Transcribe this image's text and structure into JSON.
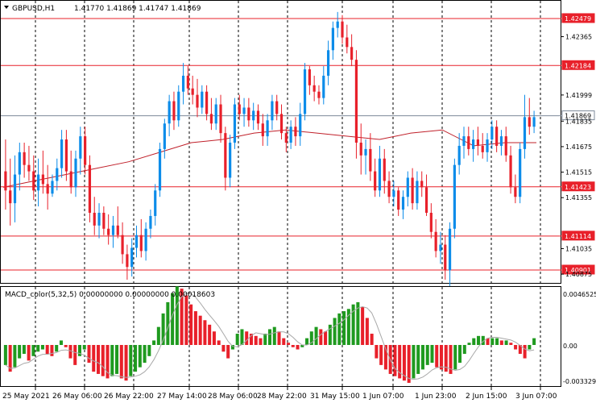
{
  "header": {
    "symbol": "GBPUSD,H1",
    "ohlc": "1.41770 1.41869 1.41747 1.41869"
  },
  "macd": {
    "label": "MACD_color(5,32,5) 0.00000000 0.00000000 0.00018603",
    "axis_labels": [
      "0.0046525",
      "0.00",
      "-0.003329"
    ]
  },
  "price_axis": {
    "labels": [
      "1.42479",
      "1.42365",
      "1.42184",
      "1.41999",
      "1.41869",
      "1.41835",
      "1.41675",
      "1.41515",
      "1.41423",
      "1.41355",
      "1.41114",
      "1.41035",
      "1.40901",
      "1.40875"
    ]
  },
  "levels": [
    {
      "value": "1.42479",
      "color": "#e8202a"
    },
    {
      "value": "1.42184",
      "color": "#e8202a"
    },
    {
      "value": "1.41869",
      "color": "#7d8a99",
      "current": true
    },
    {
      "value": "1.41423",
      "color": "#e8202a"
    },
    {
      "value": "1.41114",
      "color": "#e8202a"
    },
    {
      "value": "1.40901",
      "color": "#e8202a"
    }
  ],
  "time_axis": {
    "labels": [
      "25 May 2021",
      "26 May 06:00",
      "26 May 22:00",
      "27 May 14:00",
      "28 May 06:00",
      "28 May 22:00",
      "31 May 15:00",
      "1 Jun 07:00",
      "1 Jun 23:00",
      "2 Jun 15:00",
      "3 Jun 07:00"
    ]
  },
  "chart_data": {
    "type": "candlestick",
    "symbol": "GBPUSD",
    "timeframe": "H1",
    "ylim": [
      1.4082,
      1.4259
    ],
    "candles": [
      [
        1.4152,
        1.4172,
        1.4128,
        1.414
      ],
      [
        1.414,
        1.416,
        1.4118,
        1.4132
      ],
      [
        1.4132,
        1.4162,
        1.412,
        1.415
      ],
      [
        1.415,
        1.417,
        1.414,
        1.4164
      ],
      [
        1.4164,
        1.417,
        1.4148,
        1.4156
      ],
      [
        1.4156,
        1.4168,
        1.4146,
        1.4152
      ],
      [
        1.4152,
        1.4162,
        1.4134,
        1.414
      ],
      [
        1.414,
        1.416,
        1.413,
        1.415
      ],
      [
        1.415,
        1.4165,
        1.4138,
        1.4144
      ],
      [
        1.4144,
        1.4156,
        1.4128,
        1.4138
      ],
      [
        1.4138,
        1.415,
        1.4136,
        1.4146
      ],
      [
        1.4146,
        1.416,
        1.414,
        1.4154
      ],
      [
        1.4154,
        1.4178,
        1.4148,
        1.4172
      ],
      [
        1.4172,
        1.4178,
        1.4146,
        1.4152
      ],
      [
        1.4152,
        1.4165,
        1.4138,
        1.4142
      ],
      [
        1.4142,
        1.4165,
        1.4136,
        1.416
      ],
      [
        1.416,
        1.418,
        1.415,
        1.4174
      ],
      [
        1.4174,
        1.418,
        1.415,
        1.4156
      ],
      [
        1.4156,
        1.4162,
        1.412,
        1.4126
      ],
      [
        1.4126,
        1.4136,
        1.4112,
        1.4118
      ],
      [
        1.4118,
        1.4132,
        1.411,
        1.4126
      ],
      [
        1.4126,
        1.413,
        1.4112,
        1.4116
      ],
      [
        1.4116,
        1.4125,
        1.4106,
        1.4112
      ],
      [
        1.4112,
        1.4124,
        1.4104,
        1.4118
      ],
      [
        1.4118,
        1.413,
        1.411,
        1.4112
      ],
      [
        1.4112,
        1.412,
        1.4094,
        1.41
      ],
      [
        1.41,
        1.4106,
        1.4084,
        1.4092
      ],
      [
        1.4092,
        1.411,
        1.4086,
        1.4104
      ],
      [
        1.4104,
        1.4118,
        1.4098,
        1.4112
      ],
      [
        1.4112,
        1.4122,
        1.4098,
        1.4102
      ],
      [
        1.4102,
        1.412,
        1.4096,
        1.4116
      ],
      [
        1.4116,
        1.4128,
        1.411,
        1.4124
      ],
      [
        1.4124,
        1.4144,
        1.4118,
        1.414
      ],
      [
        1.414,
        1.417,
        1.4136,
        1.4166
      ],
      [
        1.4166,
        1.4185,
        1.416,
        1.4182
      ],
      [
        1.4182,
        1.42,
        1.4174,
        1.4196
      ],
      [
        1.4196,
        1.4202,
        1.4178,
        1.4184
      ],
      [
        1.4184,
        1.4206,
        1.418,
        1.4202
      ],
      [
        1.4202,
        1.422,
        1.4194,
        1.4212
      ],
      [
        1.4212,
        1.4218,
        1.42,
        1.4204
      ],
      [
        1.4204,
        1.4212,
        1.4194,
        1.42
      ],
      [
        1.42,
        1.421,
        1.4186,
        1.4192
      ],
      [
        1.4192,
        1.4206,
        1.4188,
        1.4202
      ],
      [
        1.4202,
        1.4206,
        1.4184,
        1.4188
      ],
      [
        1.4188,
        1.4198,
        1.4178,
        1.4182
      ],
      [
        1.4182,
        1.4198,
        1.4178,
        1.4194
      ],
      [
        1.4194,
        1.42,
        1.417,
        1.4176
      ],
      [
        1.4176,
        1.418,
        1.414,
        1.4148
      ],
      [
        1.4148,
        1.4175,
        1.4142,
        1.417
      ],
      [
        1.417,
        1.4198,
        1.4166,
        1.4194
      ],
      [
        1.4194,
        1.42,
        1.4184,
        1.4188
      ],
      [
        1.4188,
        1.4198,
        1.418,
        1.4192
      ],
      [
        1.4192,
        1.4198,
        1.418,
        1.4184
      ],
      [
        1.4184,
        1.4195,
        1.4178,
        1.419
      ],
      [
        1.419,
        1.4194,
        1.4178,
        1.4182
      ],
      [
        1.4182,
        1.4188,
        1.4168,
        1.4174
      ],
      [
        1.4174,
        1.4188,
        1.4168,
        1.4184
      ],
      [
        1.4184,
        1.42,
        1.4178,
        1.4196
      ],
      [
        1.4196,
        1.42,
        1.4184,
        1.4188
      ],
      [
        1.4188,
        1.4194,
        1.4172,
        1.4176
      ],
      [
        1.4176,
        1.418,
        1.4164,
        1.417
      ],
      [
        1.417,
        1.4184,
        1.4166,
        1.418
      ],
      [
        1.418,
        1.4186,
        1.4168,
        1.4174
      ],
      [
        1.4174,
        1.4195,
        1.4168,
        1.4188
      ],
      [
        1.4188,
        1.422,
        1.4184,
        1.4216
      ],
      [
        1.4216,
        1.4218,
        1.42,
        1.4206
      ],
      [
        1.4206,
        1.4212,
        1.4196,
        1.4202
      ],
      [
        1.4202,
        1.4206,
        1.4194,
        1.4198
      ],
      [
        1.4198,
        1.4218,
        1.4194,
        1.4212
      ],
      [
        1.4212,
        1.4234,
        1.4206,
        1.4228
      ],
      [
        1.4228,
        1.4246,
        1.4222,
        1.4242
      ],
      [
        1.4242,
        1.4252,
        1.4236,
        1.4246
      ],
      [
        1.4246,
        1.425,
        1.4232,
        1.4236
      ],
      [
        1.4236,
        1.4244,
        1.4226,
        1.423
      ],
      [
        1.423,
        1.4238,
        1.4218,
        1.4222
      ],
      [
        1.4222,
        1.4228,
        1.416,
        1.417
      ],
      [
        1.417,
        1.4182,
        1.415,
        1.4162
      ],
      [
        1.4162,
        1.4172,
        1.415,
        1.4166
      ],
      [
        1.4166,
        1.4176,
        1.4146,
        1.4152
      ],
      [
        1.4152,
        1.416,
        1.4136,
        1.414
      ],
      [
        1.414,
        1.4168,
        1.4136,
        1.416
      ],
      [
        1.416,
        1.4166,
        1.4138,
        1.4146
      ],
      [
        1.4146,
        1.4152,
        1.4132,
        1.4136
      ],
      [
        1.4136,
        1.4146,
        1.413,
        1.414
      ],
      [
        1.414,
        1.4142,
        1.4124,
        1.4128
      ],
      [
        1.4128,
        1.414,
        1.4122,
        1.4136
      ],
      [
        1.4136,
        1.4152,
        1.413,
        1.4148
      ],
      [
        1.4148,
        1.4154,
        1.4128,
        1.4132
      ],
      [
        1.4132,
        1.4152,
        1.4128,
        1.4146
      ],
      [
        1.4146,
        1.4152,
        1.4136,
        1.4142
      ],
      [
        1.4142,
        1.415,
        1.4124,
        1.4126
      ],
      [
        1.4126,
        1.4132,
        1.411,
        1.4114
      ],
      [
        1.4114,
        1.4122,
        1.4098,
        1.4102
      ],
      [
        1.4102,
        1.4114,
        1.4094,
        1.4106
      ],
      [
        1.4106,
        1.4112,
        1.4084,
        1.409
      ],
      [
        1.409,
        1.412,
        1.408,
        1.4116
      ],
      [
        1.4116,
        1.416,
        1.411,
        1.4156
      ],
      [
        1.4156,
        1.4176,
        1.415,
        1.4168
      ],
      [
        1.4168,
        1.418,
        1.416,
        1.4174
      ],
      [
        1.4174,
        1.418,
        1.4162,
        1.4166
      ],
      [
        1.4166,
        1.4178,
        1.4158,
        1.4172
      ],
      [
        1.4172,
        1.418,
        1.4162,
        1.4168
      ],
      [
        1.4168,
        1.4176,
        1.416,
        1.4164
      ],
      [
        1.4164,
        1.4176,
        1.4158,
        1.4172
      ],
      [
        1.4172,
        1.4184,
        1.4166,
        1.418
      ],
      [
        1.418,
        1.4184,
        1.4164,
        1.4168
      ],
      [
        1.4168,
        1.4178,
        1.4162,
        1.4174
      ],
      [
        1.4174,
        1.418,
        1.4158,
        1.4162
      ],
      [
        1.4162,
        1.4168,
        1.4138,
        1.4142
      ],
      [
        1.4142,
        1.415,
        1.4132,
        1.4136
      ],
      [
        1.4136,
        1.417,
        1.4132,
        1.4166
      ],
      [
        1.4166,
        1.42,
        1.416,
        1.4186
      ],
      [
        1.4186,
        1.4198,
        1.4175,
        1.418
      ],
      [
        1.418,
        1.419,
        1.4176,
        1.4186
      ]
    ],
    "moving_average": [
      1.4142,
      1.4146,
      1.415,
      1.4154,
      1.4158,
      1.4164,
      1.417,
      1.4172,
      1.4176,
      1.4178,
      1.4176,
      1.4174,
      1.4172,
      1.4176,
      1.4178,
      1.4168,
      1.417,
      1.417
    ],
    "horizontal_levels": [
      1.42479,
      1.42184,
      1.41869,
      1.41423,
      1.41114,
      1.40901
    ],
    "macd_histogram": [
      -0.0018,
      -0.0024,
      -0.002,
      -0.0012,
      -0.0008,
      -0.0014,
      -0.001,
      -0.0006,
      -0.0004,
      -0.0008,
      -0.001,
      -0.0006,
      0.0004,
      -0.0002,
      -0.0012,
      -0.0018,
      -0.001,
      -0.0004,
      -0.0016,
      -0.0024,
      -0.0026,
      -0.0028,
      -0.003,
      -0.0028,
      -0.0026,
      -0.003,
      -0.0032,
      -0.0028,
      -0.0024,
      -0.002,
      -0.0016,
      -0.001,
      0.0004,
      0.0016,
      0.0028,
      0.0038,
      0.0046,
      0.0052,
      0.005,
      0.0044,
      0.0036,
      0.003,
      0.0026,
      0.0022,
      0.0018,
      0.0012,
      0.0004,
      -0.0006,
      -0.0012,
      -0.0004,
      0.001,
      0.0014,
      0.0012,
      0.001,
      0.0008,
      0.0006,
      0.001,
      0.0014,
      0.0016,
      0.0012,
      0.0006,
      0.0002,
      -0.0002,
      -0.0004,
      -0.0002,
      0.0006,
      0.0012,
      0.0016,
      0.0014,
      0.0012,
      0.0018,
      0.0024,
      0.0028,
      0.003,
      0.0032,
      0.0036,
      0.0038,
      0.0034,
      0.0024,
      0.001,
      -0.0012,
      -0.0018,
      -0.0022,
      -0.0026,
      -0.0028,
      -0.003,
      -0.0032,
      -0.0034,
      -0.003,
      -0.0026,
      -0.0022,
      -0.0018,
      -0.0016,
      -0.002,
      -0.0022,
      -0.0024,
      -0.0026,
      -0.0022,
      -0.0016,
      -0.0008,
      0.0002,
      0.0006,
      0.0008,
      0.0008,
      0.0006,
      0.0006,
      0.0006,
      0.0004,
      0.0004,
      0.0002,
      -0.0004,
      -0.0008,
      -0.0012,
      -0.0004,
      0.0006
    ]
  }
}
